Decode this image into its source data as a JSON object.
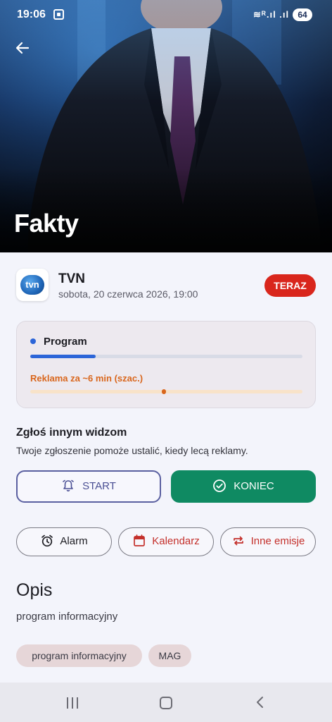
{
  "status_bar": {
    "time": "19:06",
    "signal": "≋ᴿ.ıl .ıl",
    "battery": "64"
  },
  "hero": {
    "title": "Fakty",
    "back_icon": "arrow-left-icon"
  },
  "channel": {
    "logo_text": "tvn",
    "name": "TVN",
    "datetime": "sobota, 20 czerwca 2026, 19:00",
    "badge": "TERAZ",
    "badge_color": "#d9261c"
  },
  "progress": {
    "program_label": "Program",
    "program_fraction": 0.24,
    "ad_label": "Reklama za ~6 min (szac.)",
    "ad_marker_fraction": 0.49,
    "program_color": "#2c65d8",
    "ad_color": "#d9661c"
  },
  "report": {
    "title": "Zgłoś innym widzom",
    "subtitle": "Twoje zgłoszenie pomoże ustalić, kiedy lecą reklamy.",
    "start_label": "START",
    "stop_label": "KONIEC",
    "start_icon": "alarm-bell-icon",
    "stop_icon": "check-circle-icon",
    "stop_color": "#0f8a62"
  },
  "actions": {
    "alarm_label": "Alarm",
    "calendar_label": "Kalendarz",
    "repeat_label": "Inne emisje",
    "alarm_icon": "alarm-clock-icon",
    "calendar_icon": "calendar-icon",
    "repeat_icon": "repeat-icon"
  },
  "description": {
    "title": "Opis",
    "text": "program informacyjny",
    "tags": [
      "program informacyjny",
      "MAG"
    ]
  }
}
